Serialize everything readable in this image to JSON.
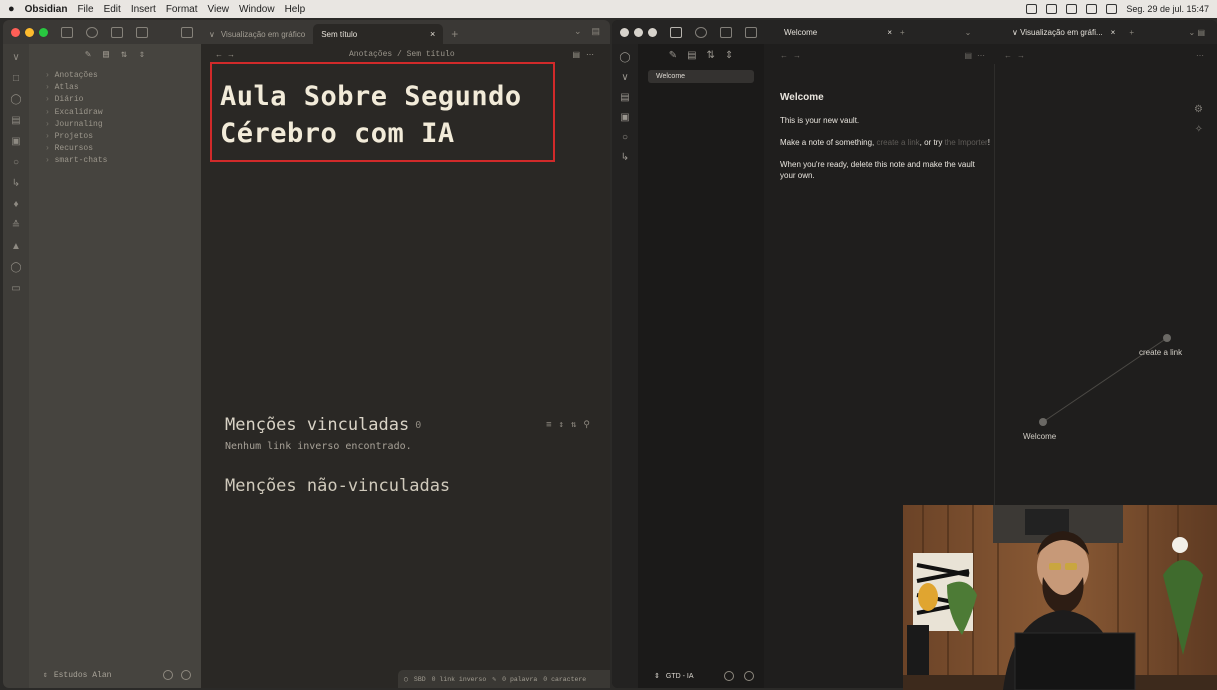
{
  "menubar": {
    "apple": "",
    "app": "Obsidian",
    "items": [
      "File",
      "Edit",
      "Insert",
      "Format",
      "View",
      "Window",
      "Help"
    ],
    "clock": "Seg. 29 de jul. 15:47"
  },
  "left_window": {
    "tab_graph": "Visualização em gráfico",
    "tab_active": "Sem título",
    "breadcrumb": "Anotações / Sem título",
    "folders": [
      "Anotações",
      "Atlas",
      "Diário",
      "Excalidraw",
      "Journaling",
      "Projetos",
      "Recursos",
      "smart-chats"
    ],
    "vault_name": "Estudos Alan",
    "title_line1": "Aula Sobre Segundo",
    "title_line2": "Cérebro com IA",
    "linked_mentions": "Menções vinculadas",
    "linked_count": "0",
    "no_backlinks": "Nenhum link inverso encontrado.",
    "unlinked_mentions": "Menções não-vinculadas",
    "status": {
      "sync": "SBD",
      "backlinks": "0 link inverso",
      "words": "0 palavra",
      "chars": "0 caractere"
    }
  },
  "right_window": {
    "file_selected": "Welcome",
    "vault_name": "GTD - IA",
    "tab_welcome": "Welcome",
    "tab_graph": "Visualização em gráfi...",
    "note": {
      "heading": "Welcome",
      "p1": "This is your new vault.",
      "p2_a": "Make a note of something,",
      "p2_link": "create a link",
      "p2_b": ", or",
      "p2_c": "try",
      "p2_link2": "the Importer",
      "p2_d": "!",
      "p3": "When you're ready, delete this note and make the vault your own."
    },
    "graph_nodes": {
      "a": "create a link",
      "b": "Welcome"
    }
  },
  "colors": {
    "traffic_red": "#ff5f57",
    "traffic_yellow": "#febc2e",
    "traffic_green": "#28c840",
    "highlight_box": "#d12a2a"
  }
}
